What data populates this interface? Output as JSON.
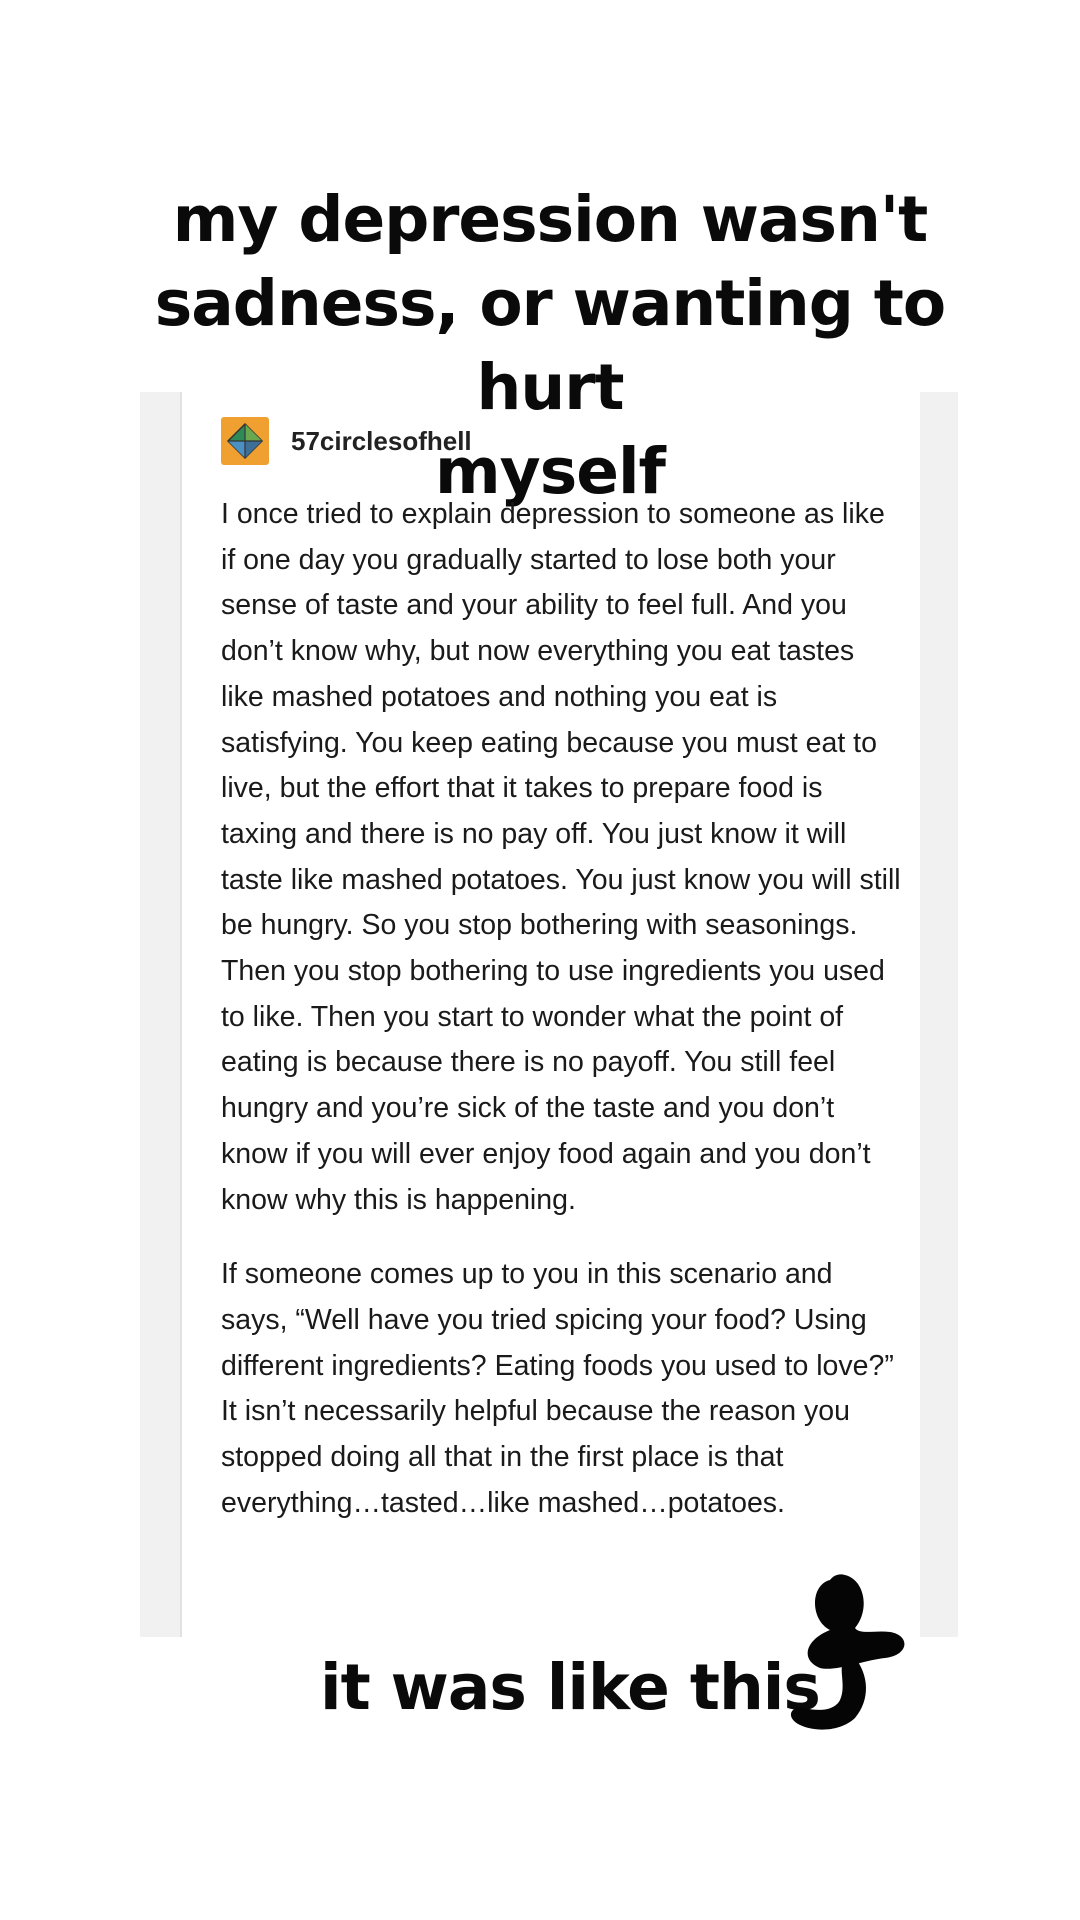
{
  "headline": {
    "line1": "my depression wasn't",
    "line2": "sadness, or wanting to hurt",
    "line3": "myself"
  },
  "post": {
    "username": "57circlesofhell",
    "avatar_icon": "diamond-avatar-icon",
    "avatar_color": "#f0a030",
    "paragraphs": [
      "I once tried to explain depression to someone as like if one day you gradually started to lose both your sense of taste and your ability to feel full. And you don’t know why, but now everything you eat tastes like mashed potatoes and nothing you eat is satisfying. You keep eating because you must eat to live, but the effort that it takes to prepare food is taxing and there is no pay off. You just know it will taste like mashed potatoes. You just know you will still be hungry. So you stop bothering with seasonings. Then you stop bothering to use ingredients you used to like. Then you start to wonder what the point of eating is because there is no payoff. You still feel hungry and you’re sick of the taste and you don’t know if you will ever enjoy food again and you don’t know why this is happening.",
      "If someone comes up to you in this scenario and says, “Well have you tried spicing your food? Using different ingredients? Eating foods you used to love?” It isn’t necessarily helpful because the reason you stopped doing all that in the first place is that everything…tasted…like mashed…potatoes."
    ]
  },
  "footer": {
    "caption": "it was like this",
    "arrow_icon": "hand-drawn-arrow-icon"
  },
  "colors": {
    "background": "#ffffff",
    "card_frame": "#f1f1f1",
    "text": "#1a1a1a"
  }
}
